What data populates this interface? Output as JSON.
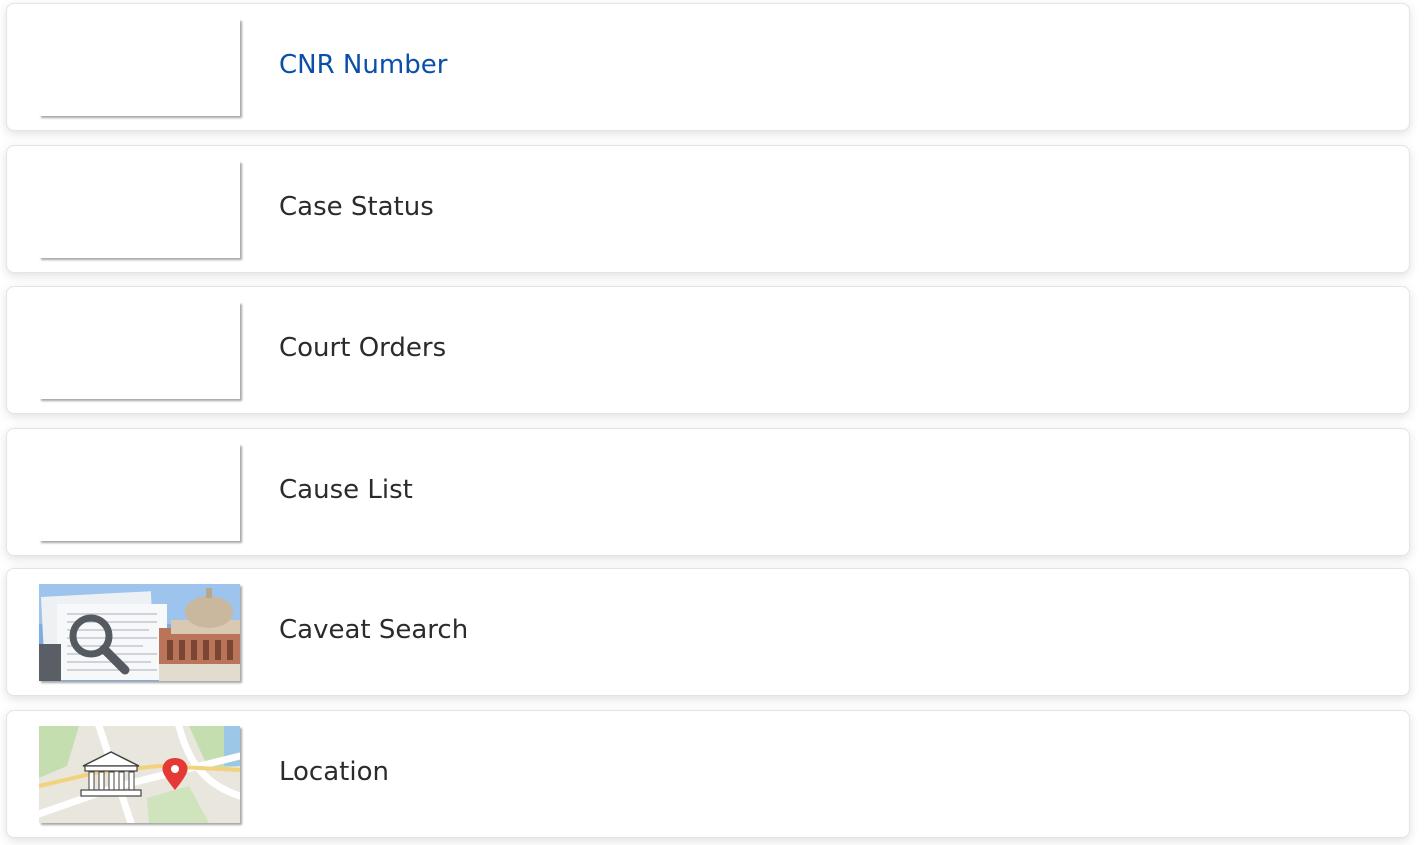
{
  "menu": {
    "items": [
      {
        "label": "CNR Number",
        "active": true,
        "thumbnail": "blank"
      },
      {
        "label": "Case Status",
        "active": false,
        "thumbnail": "blank"
      },
      {
        "label": "Court Orders",
        "active": false,
        "thumbnail": "blank"
      },
      {
        "label": "Cause List",
        "active": false,
        "thumbnail": "blank"
      },
      {
        "label": "Caveat Search",
        "active": false,
        "thumbnail": "court-building-magnifier-image"
      },
      {
        "label": "Location",
        "active": false,
        "thumbnail": "map-courthouse-pin-image"
      }
    ]
  },
  "colors": {
    "active_label": "#0b4fa8",
    "label": "#2b2b2b",
    "card_border": "#e4e4e4"
  }
}
